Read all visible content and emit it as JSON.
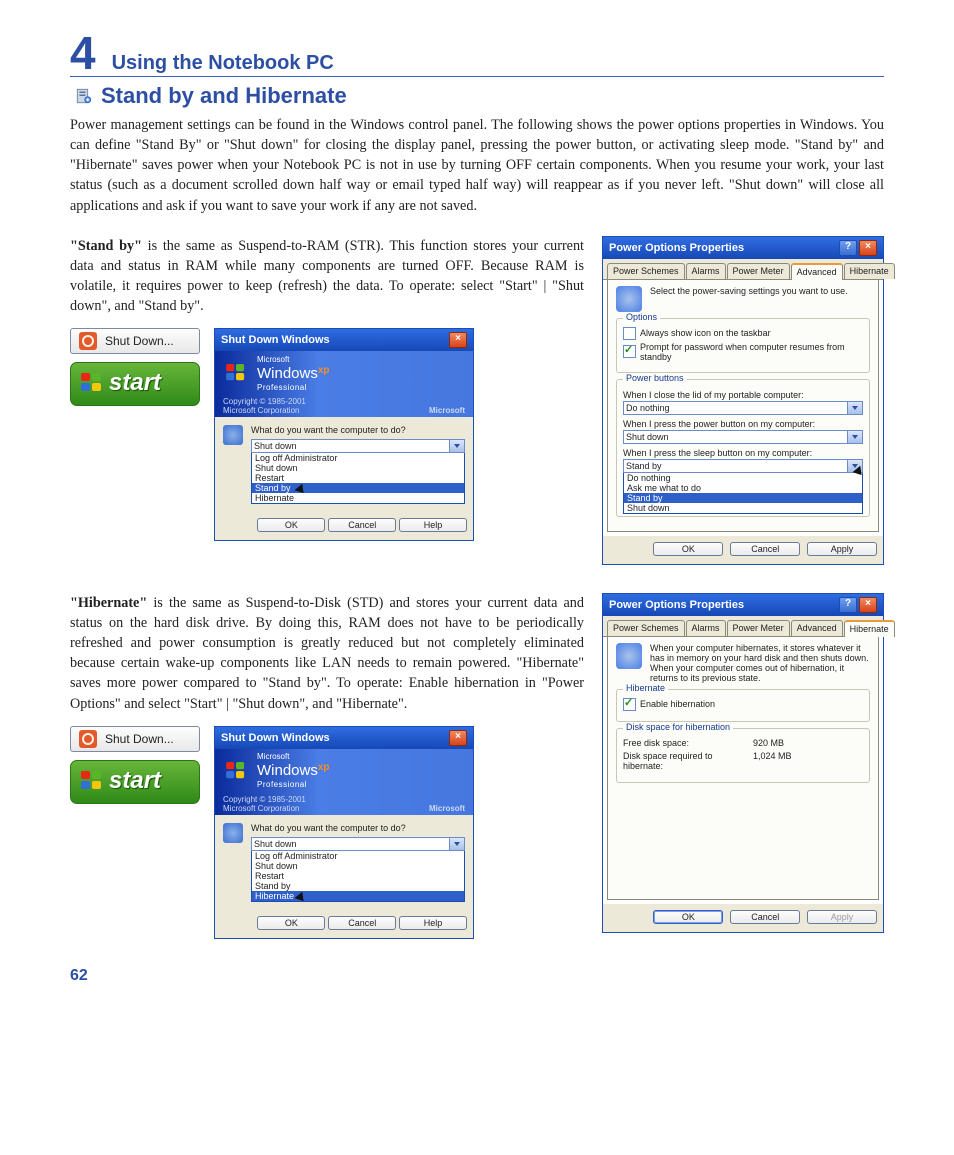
{
  "chapter": {
    "number": "4",
    "title": "Using the Notebook PC"
  },
  "section": {
    "title": "Stand by and Hibernate"
  },
  "intro": "Power management settings can be found in the Windows control panel. The following shows the power options properties in Windows. You can define \"Stand By\" or \"Shut down\" for closing the display panel, pressing the power button, or activating sleep mode. \"Stand by\" and \"Hibernate\" saves power when your Notebook PC is not in use by turning OFF certain components. When you resume your work, your last status (such as a document scrolled down half way or email typed half way) will reappear as if you never left. \"Shut down\" will close all applications and ask if you want to save your work if any are not saved.",
  "standby": {
    "label": "\"Stand by\"",
    "text": " is the same as Suspend-to-RAM (STR). This function stores your current data and status in RAM while many components are turned OFF. Because RAM is volatile, it requires power to keep (refresh) the data. To operate: select \"Start\" | \"Shut down\", and \"Stand by\"."
  },
  "hibernate": {
    "label": "\"Hibernate\"",
    "text": " is the same as  Suspend-to-Disk (STD) and stores your current data and status on the hard disk drive. By doing this, RAM does not have to be periodically refreshed and power consumption is greatly reduced but not completely eliminated because certain wake-up components like LAN needs to remain powered. \"Hibernate\" saves more power compared to \"Stand by\". To operate: Enable hibernation in \"Power Options\" and select \"Start\" | \"Shut down\", and \"Hibernate\"."
  },
  "startmenu": {
    "shutdown_label": "Shut Down...",
    "start_label": "start"
  },
  "shutdown_dialog": {
    "title": "Shut Down Windows",
    "logo_win": "Windows",
    "logo_xp": "xp",
    "logo_sub": "Professional",
    "copyright": "Copyright © 1985-2001",
    "corp": "Microsoft Corporation",
    "ms": "Microsoft",
    "prompt": "What do you want the computer to do?",
    "selected": "Shut down",
    "options1": [
      "Log off Administrator",
      "Shut down",
      "Restart",
      "Stand by",
      "Hibernate"
    ],
    "selected_index1": 3,
    "selected_index2": 4,
    "buttons": {
      "ok": "OK",
      "cancel": "Cancel",
      "help": "Help"
    }
  },
  "power_dialog": {
    "title": "Power Options Properties",
    "tabs": [
      "Power Schemes",
      "Alarms",
      "Power Meter",
      "Advanced",
      "Hibernate"
    ],
    "advanced": {
      "intro": "Select the power-saving settings you want to use.",
      "grp_options": "Options",
      "chk1": {
        "label": "Always show icon on the taskbar",
        "checked": false
      },
      "chk2": {
        "label": "Prompt for password when computer resumes from standby",
        "checked": true
      },
      "grp_buttons": "Power buttons",
      "q_lid": "When I close the lid of my portable computer:",
      "v_lid": "Do nothing",
      "q_power": "When I press the power button on my computer:",
      "v_power": "Shut down",
      "q_sleep": "When I press the sleep button on my computer:",
      "v_sleep": "Stand by",
      "sleep_options": [
        "Do nothing",
        "Ask me what to do",
        "Stand by",
        "Shut down"
      ],
      "sleep_selected_index": 2
    },
    "hibernate_tab": {
      "intro": "When your computer hibernates, it stores whatever it has in memory on your hard disk and then shuts down. When your computer comes out of hibernation, it returns to its previous state.",
      "grp_h": "Hibernate",
      "chk": {
        "label": "Enable hibernation",
        "checked": true
      },
      "grp_disk": "Disk space for hibernation",
      "free_k": "Free disk space:",
      "free_v": "920 MB",
      "req_k": "Disk space required to hibernate:",
      "req_v": "1,024 MB"
    },
    "buttons": {
      "ok": "OK",
      "cancel": "Cancel",
      "apply": "Apply"
    }
  },
  "page_number": "62"
}
